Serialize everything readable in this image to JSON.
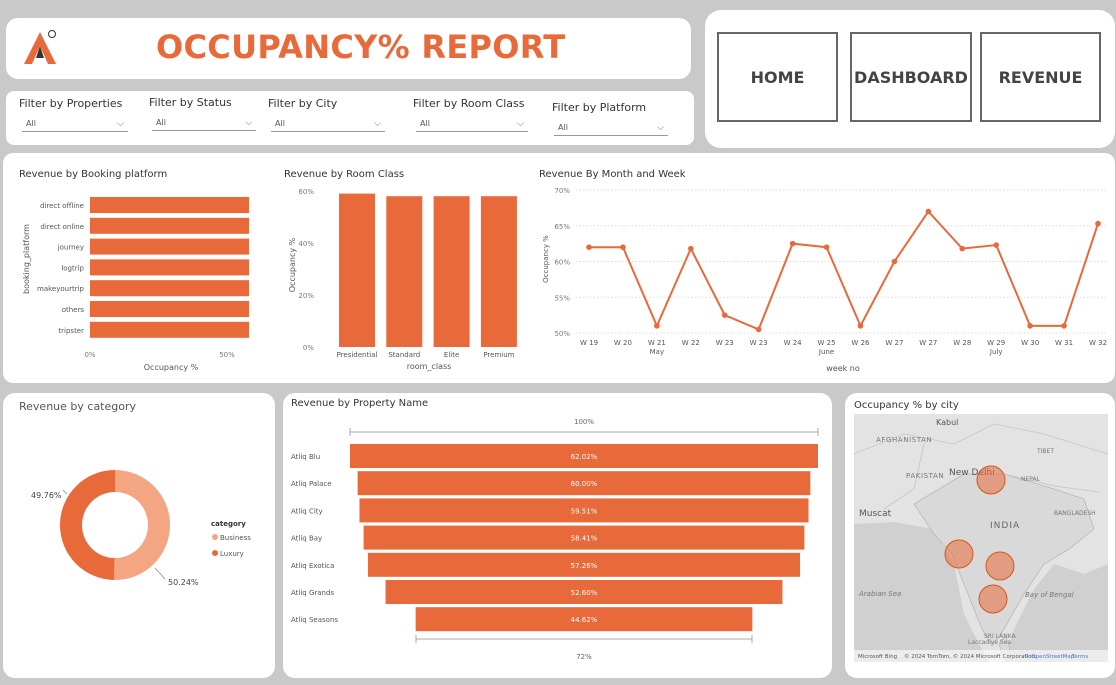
{
  "header": {
    "title": "OCCUPANCY% REPORT",
    "logo": "atliq-logo-icon"
  },
  "nav": {
    "home": "HOME",
    "dashboard": "DASHBOARD",
    "revenue": "REVENUE"
  },
  "filters": [
    {
      "label": "Filter by Properties",
      "value": "All"
    },
    {
      "label": "Filter by Status",
      "value": "All"
    },
    {
      "label": "Filter by City",
      "value": "All"
    },
    {
      "label": "Filter by Room Class",
      "value": "All"
    },
    {
      "label": "Filter by Platform",
      "value": "All"
    }
  ],
  "colors": {
    "accent": "#e8693a",
    "accent_light": "#f4a582",
    "card": "#ffffff",
    "background": "#c9c9c9"
  },
  "chart_data": [
    {
      "type": "bar",
      "orientation": "horizontal",
      "title": "Revenue by Booking platform",
      "xlabel": "Occupancy %",
      "ylabel": "booking_platform",
      "categories": [
        "direct offline",
        "direct online",
        "journey",
        "logtrip",
        "makeyourtrip",
        "others",
        "tripster"
      ],
      "values": [
        58,
        58,
        58,
        58,
        58,
        58,
        58
      ],
      "xlim": [
        0,
        58
      ],
      "xticks": [
        "0%",
        "50%"
      ]
    },
    {
      "type": "bar",
      "title": "Revenue by Room Class",
      "xlabel": "room_class",
      "ylabel": "Occupancy %",
      "categories": [
        "Presidential",
        "Standard",
        "Elite",
        "Premium"
      ],
      "values": [
        59,
        58,
        58,
        58
      ],
      "ylim": [
        0,
        60
      ],
      "yticks": [
        "0%",
        "20%",
        "40%",
        "60%"
      ]
    },
    {
      "type": "line",
      "title": "Revenue By Month and Week",
      "xlabel": "week no",
      "ylabel": "Occupancy %",
      "x": [
        "W 19",
        "W 20",
        "W 21",
        "W 22",
        "W 23",
        "W 23",
        "W 24",
        "W 25",
        "W 26",
        "W 27",
        "W 27",
        "W 28",
        "W 29",
        "W 30",
        "W 31",
        "W 32"
      ],
      "values": [
        62,
        62,
        51,
        61.8,
        52.5,
        50.5,
        62.5,
        62,
        51,
        60,
        67,
        61.8,
        62.3,
        51,
        51,
        65.3
      ],
      "months": [
        {
          "label": "May",
          "index": 2
        },
        {
          "label": "June",
          "index": 7
        },
        {
          "label": "July",
          "index": 12
        }
      ],
      "ylim": [
        50,
        70
      ],
      "yticks": [
        "50%",
        "55%",
        "60%",
        "65%",
        "70%"
      ],
      "grid": true
    },
    {
      "type": "pie",
      "title": "Revenue by category",
      "legend_title": "category",
      "labels": [
        "Business",
        "Luxury"
      ],
      "values": [
        50.24,
        49.76
      ],
      "value_labels": [
        "50.24%",
        "49.76%"
      ],
      "legend": "right"
    },
    {
      "type": "bar",
      "subtype": "funnel",
      "title": "Revenue by Property Name",
      "categories": [
        "Atliq Blu",
        "Atliq Palace",
        "Atliq City",
        "Atliq Bay",
        "Atliq Exotica",
        "Atliq Grands",
        "Atliq Seasons"
      ],
      "values": [
        62.02,
        60.0,
        59.51,
        58.41,
        57.26,
        52.6,
        44.62
      ],
      "value_labels": [
        "62.02%",
        "60.00%",
        "59.51%",
        "58.41%",
        "57.26%",
        "52.60%",
        "44.62%"
      ],
      "top_label": "100%",
      "bottom_label": "72%"
    }
  ],
  "map": {
    "title": "Occupancy % by city",
    "labels": [
      "AFGHANISTAN",
      "Kabul",
      "PAKISTAN",
      "New Delhi",
      "NEPAL",
      "TIBET",
      "Muscat",
      "INDIA",
      "BANGLADESH",
      "Arabian Sea",
      "Bay of Bengal",
      "SRI LANKA",
      "Laccadive Sea"
    ],
    "footer_brand": "Microsoft Bing",
    "attribution": "© 2024 TomTom, © 2024 Microsoft Corporation,",
    "attribution_link": "© OpenStreetMap",
    "terms": "Terms",
    "cities": [
      "Delhi",
      "Mumbai",
      "Hyderabad",
      "Bangalore"
    ]
  }
}
